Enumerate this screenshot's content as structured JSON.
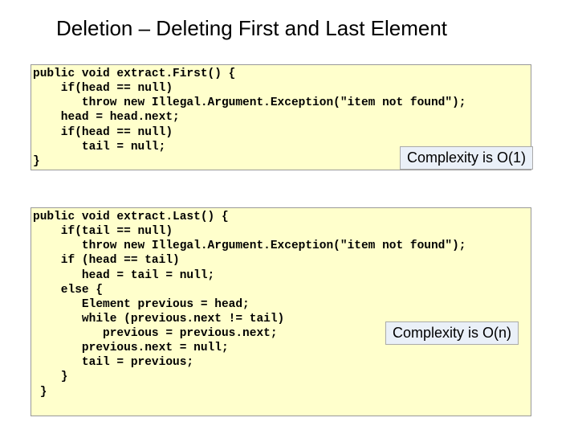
{
  "title": "Deletion – Deleting First and Last Element",
  "code1": "public void extract.First() {\n    if(head == null)\n       throw new Illegal.Argument.Exception(\"item not found\");\n    head = head.next;\n    if(head == null)\n       tail = null;\n}",
  "code2": "public void extract.Last() {\n    if(tail == null)\n       throw new Illegal.Argument.Exception(\"item not found\");\n    if (head == tail)\n       head = tail = null;\n    else {\n       Element previous = head;\n       while (previous.next != tail)\n          previous = previous.next;\n       previous.next = null;\n       tail = previous;\n    }\n }",
  "complexity1": "Complexity is O(1)",
  "complexity2": "Complexity is O(n)"
}
